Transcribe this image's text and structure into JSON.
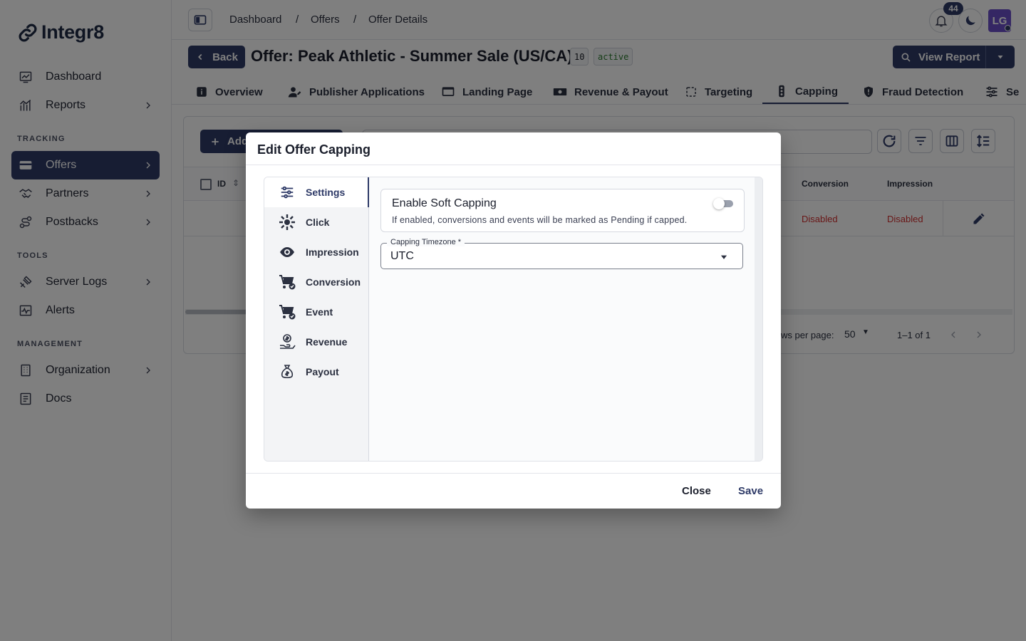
{
  "app": {
    "name": "Integr8",
    "user_initials": "LG",
    "notifications": "44"
  },
  "sidebar": {
    "items_top": [
      {
        "label": "Dashboard"
      },
      {
        "label": "Reports"
      }
    ],
    "sections": {
      "tracking": "TRACKING",
      "tools": "TOOLS",
      "management": "MANAGEMENT"
    },
    "tracking": [
      {
        "label": "Offers"
      },
      {
        "label": "Partners"
      },
      {
        "label": "Postbacks"
      }
    ],
    "tools": [
      {
        "label": "Server Logs"
      },
      {
        "label": "Alerts"
      }
    ],
    "management": [
      {
        "label": "Organization"
      },
      {
        "label": "Docs"
      }
    ]
  },
  "breadcrumb": [
    "Dashboard",
    "Offers",
    "Offer Details"
  ],
  "header": {
    "back_label": "Back",
    "title": "Offer: Peak Athletic - Summer Sale (US/CA)",
    "id": "10",
    "status": "active",
    "view_report_label": "View Report"
  },
  "tabs": [
    "Overview",
    "Publisher Applications",
    "Landing Page",
    "Revenue & Payout",
    "Targeting",
    "Capping",
    "Fraud Detection",
    "Se"
  ],
  "table": {
    "add_label": "Add",
    "columns": {
      "id": "ID",
      "conversion": "Conversion",
      "impression": "Impression"
    },
    "row": {
      "conversion": "Disabled",
      "impression": "Disabled"
    },
    "rows_per_page_label": "ws per page:",
    "rows_per_page": "50",
    "range": "1–1 of 1"
  },
  "modal": {
    "title": "Edit Offer Capping",
    "nav": [
      "Settings",
      "Click",
      "Impression",
      "Conversion",
      "Event",
      "Revenue",
      "Payout"
    ],
    "soft_capping": {
      "label": "Enable Soft Capping",
      "description": "If enabled, conversions and events will be marked as Pending if capped.",
      "enabled": false
    },
    "timezone": {
      "label": "Capping Timezone *",
      "value": "UTC"
    },
    "close_label": "Close",
    "save_label": "Save"
  },
  "colors": {
    "primary": "#2e3a67",
    "danger": "#d32f2f",
    "status_green": "#2e7d32"
  }
}
